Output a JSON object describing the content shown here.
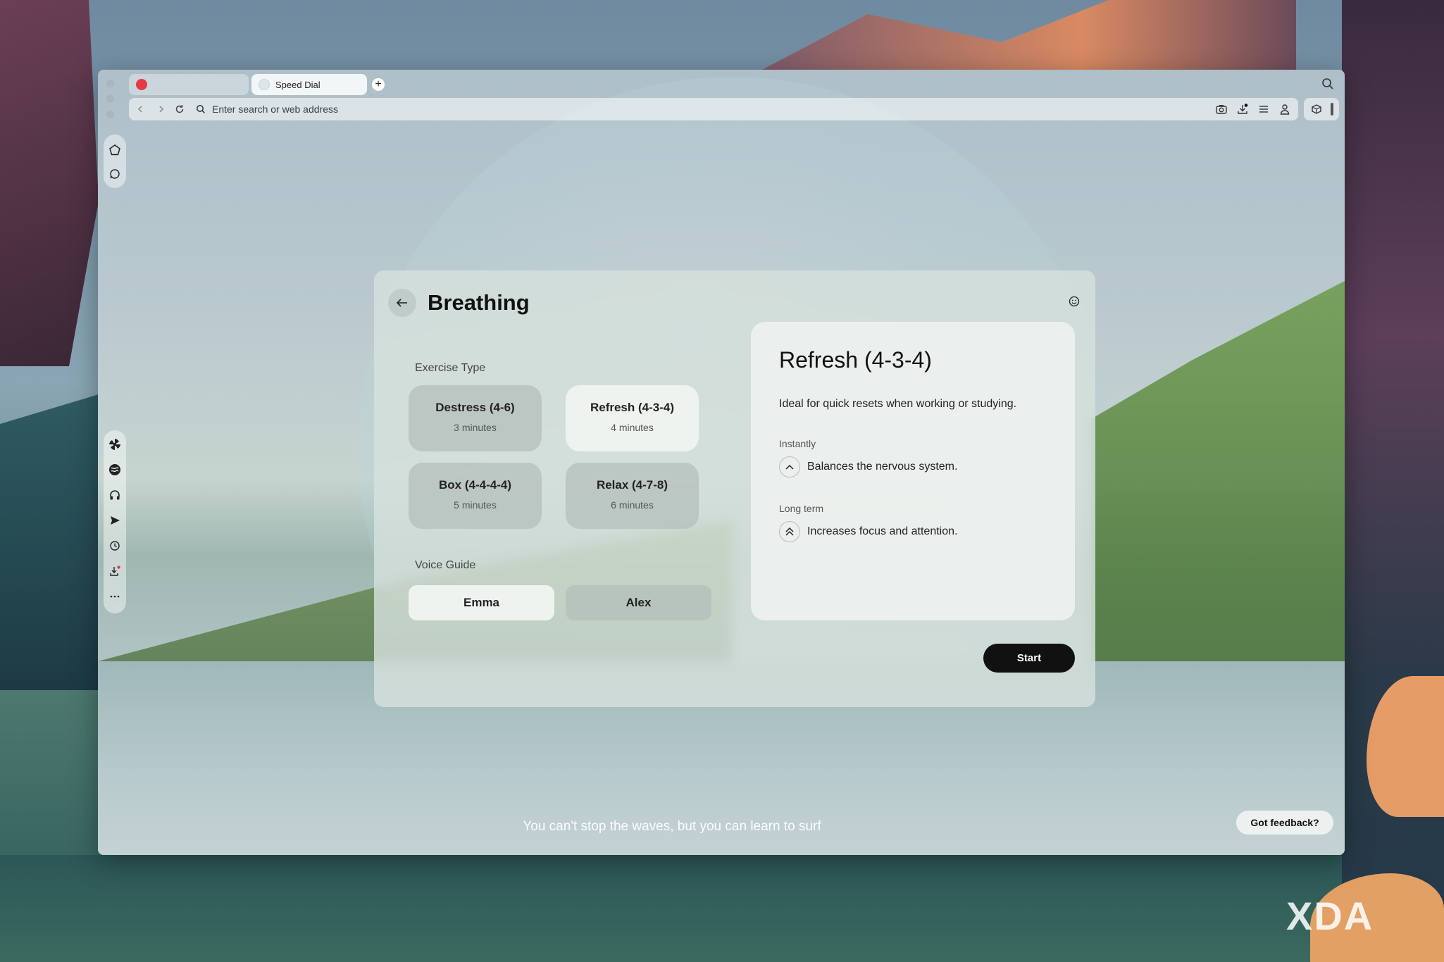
{
  "browser": {
    "tabs": [
      {
        "label": "",
        "favicon": "red-logo-icon"
      },
      {
        "label": "Speed Dial",
        "favicon": "speed-dial-icon"
      }
    ],
    "address_placeholder": "Enter search or web address"
  },
  "panel": {
    "title": "Breathing",
    "exercise_section_label": "Exercise Type",
    "exercises": [
      {
        "name": "Destress (4-6)",
        "duration": "3 minutes",
        "selected": false
      },
      {
        "name": "Refresh (4-3-4)",
        "duration": "4 minutes",
        "selected": true
      },
      {
        "name": "Box (4-4-4-4)",
        "duration": "5 minutes",
        "selected": false
      },
      {
        "name": "Relax (4-7-8)",
        "duration": "6 minutes",
        "selected": false
      }
    ],
    "voice_section_label": "Voice Guide",
    "voices": [
      {
        "name": "Emma",
        "selected": true
      },
      {
        "name": "Alex",
        "selected": false
      }
    ],
    "detail": {
      "title": "Refresh (4-3-4)",
      "description": "Ideal for quick resets when working or studying.",
      "instantly_label": "Instantly",
      "instantly_text": "Balances the nervous system.",
      "longterm_label": "Long term",
      "longterm_text": "Increases focus and attention."
    },
    "start_label": "Start"
  },
  "quote": "You can't stop the waves, but you can learn to surf",
  "feedback_label": "Got feedback?",
  "watermark": "XDA",
  "colors": {
    "start_button": "#111111",
    "selected_card": "#f0f4f2",
    "tab_favicon": "#e53946"
  }
}
